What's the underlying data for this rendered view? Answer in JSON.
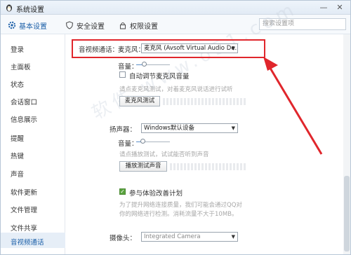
{
  "window": {
    "title": "系统设置"
  },
  "titlebar": {
    "minimize_icon": "minimize-icon",
    "close_icon": "close-icon"
  },
  "tabs": [
    {
      "label": "基本设置",
      "icon": "gear-icon",
      "active": true
    },
    {
      "label": "安全设置",
      "icon": "shield-icon"
    },
    {
      "label": "权限设置",
      "icon": "lock-icon"
    }
  ],
  "search": {
    "placeholder": "搜索设置项"
  },
  "sidebar": {
    "items": [
      {
        "label": "登录"
      },
      {
        "label": "主面板"
      },
      {
        "label": "状态"
      },
      {
        "label": "会话窗口"
      },
      {
        "label": "信息展示"
      },
      {
        "label": "提醒"
      },
      {
        "label": "热键"
      },
      {
        "label": "声音"
      },
      {
        "label": "软件更新"
      },
      {
        "label": "文件管理"
      },
      {
        "label": "文件共享"
      },
      {
        "label": "音视频通话",
        "active": true
      }
    ]
  },
  "content": {
    "section_label": "音视频通话：",
    "mic": {
      "label": "麦克风：",
      "value": "麦克风 (Avsoft Virtual Audio De...",
      "volume_label": "音量：",
      "volume_level": 0.25,
      "auto_adjust": "自动调节麦克风音量",
      "test_note": "请点麦克风测试，对着麦克风说话进行试听",
      "test_button": "麦克风测试"
    },
    "speaker": {
      "label": "扬声器：",
      "value": "Windows默认设备",
      "volume_label": "音量：",
      "volume_level": 0.2,
      "test_note": "请点播放测试，试试能否听到声音",
      "test_button": "播放测试声音"
    },
    "experience": {
      "label": "参与体验改善计划",
      "checked": true,
      "note_line1": "为了提升网络连接质量，我们可能会通过QQ对",
      "note_line2": "你的网络进行检测。消耗流量不大于10MB。"
    },
    "camera": {
      "label": "摄像头：",
      "value": "Integrated Camera"
    }
  },
  "colors": {
    "annotation": "#e0262c",
    "accent": "#1b5fa8"
  }
}
